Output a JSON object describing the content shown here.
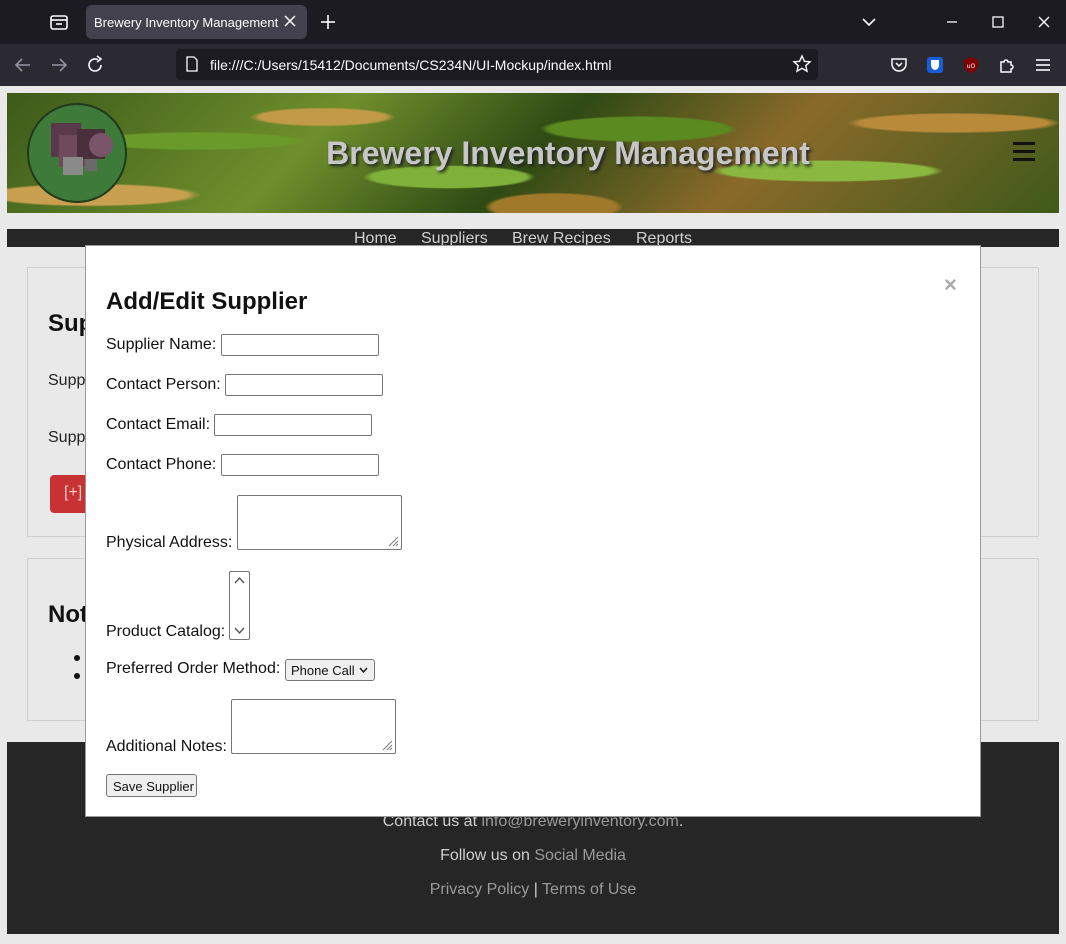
{
  "browser": {
    "tab_title": "Brewery Inventory Management",
    "url": "file:///C:/Users/15412/Documents/CS234N/UI-Mockup/index.html"
  },
  "site": {
    "title": "Brewery Inventory Management",
    "nav": [
      "Home",
      "Suppliers",
      "Brew Recipes",
      "Reports"
    ]
  },
  "background_sections": {
    "suppliers_heading": "Sup",
    "label_1": "Supp",
    "label_2": "Supp",
    "add_button": "[+]",
    "notes_heading": "Not"
  },
  "footer": {
    "contact_prefix": "Contact us at ",
    "contact_email": "info@breweryinventory.com",
    "contact_suffix": ".",
    "follow_prefix": "Follow us on ",
    "follow_link": "Social Media",
    "privacy": "Privacy Policy",
    "separator": " | ",
    "terms": "Terms of Use"
  },
  "modal": {
    "title": "Add/Edit Supplier",
    "close": "×",
    "fields": {
      "supplier_name": "Supplier Name:",
      "contact_person": "Contact Person:",
      "contact_email": "Contact Email:",
      "contact_phone": "Contact Phone:",
      "physical_address": "Physical Address:",
      "product_catalog": "Product Catalog:",
      "preferred_order_method": "Preferred Order Method:",
      "additional_notes": "Additional Notes:"
    },
    "order_method_selected": "Phone Call",
    "save_button": "Save Supplier"
  }
}
